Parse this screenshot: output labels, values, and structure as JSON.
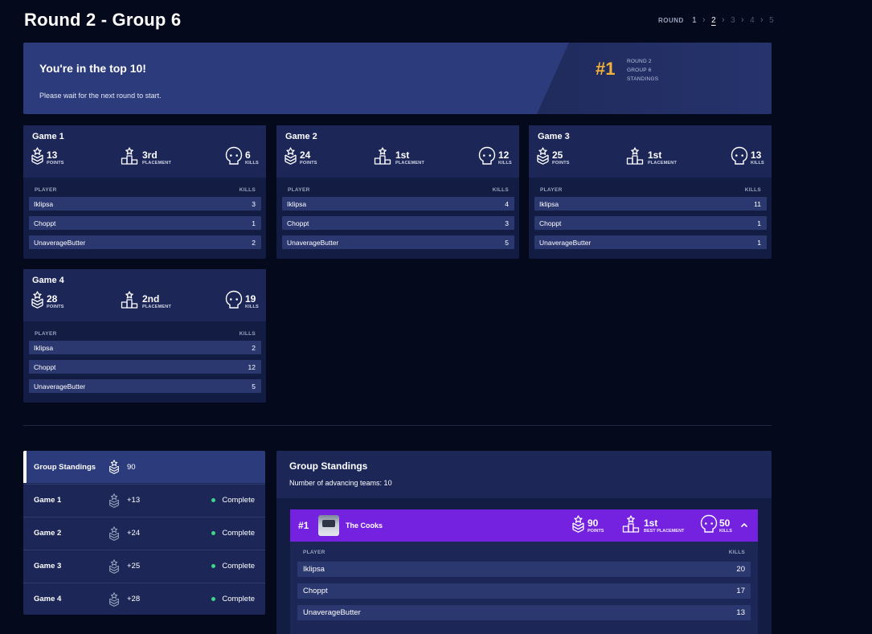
{
  "page": {
    "title": "Round 2 - Group 6"
  },
  "round_nav": {
    "label": "ROUND",
    "rounds": [
      "1",
      "2",
      "3",
      "4",
      "5"
    ],
    "active": "2"
  },
  "banner": {
    "title": "You're in the top 10!",
    "subtitle": "Please wait for the next round to start.",
    "rank": "#1",
    "info_lines": [
      "ROUND 2",
      "GROUP 6",
      "STANDINGS"
    ]
  },
  "stat_labels": {
    "points": "POINTS",
    "placement": "PLACEMENT",
    "kills": "KILLS",
    "best_placement": "BEST PLACEMENT"
  },
  "table_headers": {
    "player": "PLAYER",
    "kills": "KILLS"
  },
  "games": [
    {
      "title": "Game 1",
      "points": "13",
      "placement": "3rd",
      "kills": "6",
      "players": [
        {
          "name": "Iklipsa",
          "kills": "3"
        },
        {
          "name": "Choppt",
          "kills": "1"
        },
        {
          "name": "UnaverageButter",
          "kills": "2"
        }
      ]
    },
    {
      "title": "Game 2",
      "points": "24",
      "placement": "1st",
      "kills": "12",
      "players": [
        {
          "name": "Iklipsa",
          "kills": "4"
        },
        {
          "name": "Choppt",
          "kills": "3"
        },
        {
          "name": "UnaverageButter",
          "kills": "5"
        }
      ]
    },
    {
      "title": "Game 3",
      "points": "25",
      "placement": "1st",
      "kills": "13",
      "players": [
        {
          "name": "Iklipsa",
          "kills": "11"
        },
        {
          "name": "Choppt",
          "kills": "1"
        },
        {
          "name": "UnaverageButter",
          "kills": "1"
        }
      ]
    },
    {
      "title": "Game 4",
      "points": "28",
      "placement": "2nd",
      "kills": "19",
      "players": [
        {
          "name": "Iklipsa",
          "kills": "2"
        },
        {
          "name": "Choppt",
          "kills": "12"
        },
        {
          "name": "UnaverageButter",
          "kills": "5"
        }
      ]
    }
  ],
  "side_list": [
    {
      "label": "Group Standings",
      "points": "90",
      "status": ""
    },
    {
      "label": "Game 1",
      "points": "+13",
      "status": "Complete"
    },
    {
      "label": "Game 2",
      "points": "+24",
      "status": "Complete"
    },
    {
      "label": "Game 3",
      "points": "+25",
      "status": "Complete"
    },
    {
      "label": "Game 4",
      "points": "+28",
      "status": "Complete"
    }
  ],
  "standings": {
    "title": "Group Standings",
    "subtitle": "Number of advancing teams: 10",
    "team": {
      "rank": "#1",
      "name": "The Cooks",
      "points": "90",
      "best_placement": "1st",
      "kills": "50",
      "players": [
        {
          "name": "Iklipsa",
          "kills": "20"
        },
        {
          "name": "Choppt",
          "kills": "17"
        },
        {
          "name": "UnaverageButter",
          "kills": "13"
        }
      ]
    }
  },
  "colors": {
    "background": "#040a1c",
    "banner": "#2c3b7b",
    "rank_gold": "#f3b13a",
    "team_purple": "#7522e0",
    "complete_green": "#3dd68c"
  },
  "icons": {
    "points": "chevron-badge-icon",
    "placement": "podium-star-icon",
    "kills": "skull-icon",
    "expand": "chevron-up-icon"
  }
}
